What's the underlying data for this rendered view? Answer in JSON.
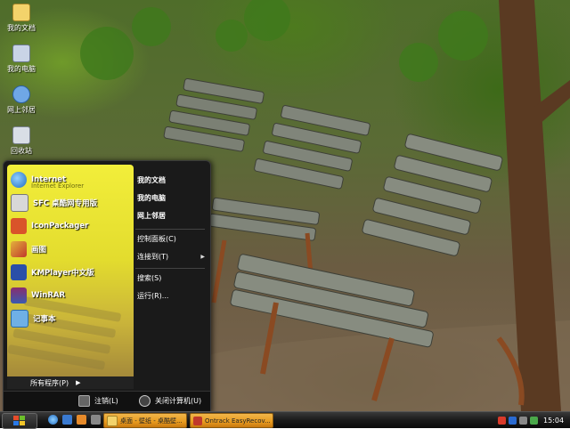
{
  "desktop": {
    "icons": [
      {
        "label": "我的文档",
        "icon": "my-documents-icon",
        "color": "#f3d36b"
      },
      {
        "label": "我的电脑",
        "icon": "my-computer-icon",
        "color": "#c9d4e6"
      },
      {
        "label": "网上邻居",
        "icon": "network-icon",
        "color": "#6fa7e6"
      },
      {
        "label": "回收站",
        "icon": "recycle-bin-icon",
        "color": "#d9dee6"
      }
    ]
  },
  "start_menu": {
    "programs": [
      {
        "label": "Internet",
        "sub": "Internet Explorer",
        "icon": "internet-explorer-icon",
        "color": "#3b8de0"
      },
      {
        "label": "SFC 桌酷网专用版",
        "sub": "",
        "icon": "sfc-icon",
        "color": "#d8d8d8"
      },
      {
        "label": "IconPackager",
        "sub": "",
        "icon": "iconpackager-icon",
        "color": "#d9542a"
      },
      {
        "label": "画图",
        "sub": "",
        "icon": "paint-icon",
        "color": "#e3b23c"
      },
      {
        "label": "KMPlayer中文版",
        "sub": "",
        "icon": "kmplayer-icon",
        "color": "#2a4fa8"
      },
      {
        "label": "WinRAR",
        "sub": "",
        "icon": "winrar-icon",
        "color": "#8a2e6e"
      },
      {
        "label": "记事本",
        "sub": "",
        "icon": "notepad-icon",
        "color": "#6fb0e6"
      }
    ],
    "all_programs": "所有程序(P)",
    "right_items": {
      "my_documents": "我的文档",
      "my_computer": "我的电脑",
      "network": "网上邻居",
      "control_panel": "控制面板(C)",
      "connect_to": "连接到(T)",
      "search": "搜索(S)",
      "run": "运行(R)..."
    },
    "logoff": "注销(L)",
    "shutdown": "关闭计算机(U)"
  },
  "taskbar": {
    "tasks": [
      {
        "label": "桌面 - 壁纸 - 桌酷壁...",
        "icon": "folder-icon",
        "color": "#f3d36b"
      },
      {
        "label": "Ontrack EasyRecov...",
        "icon": "ontrack-icon",
        "color": "#c0392b"
      }
    ],
    "clock": "15:04"
  }
}
